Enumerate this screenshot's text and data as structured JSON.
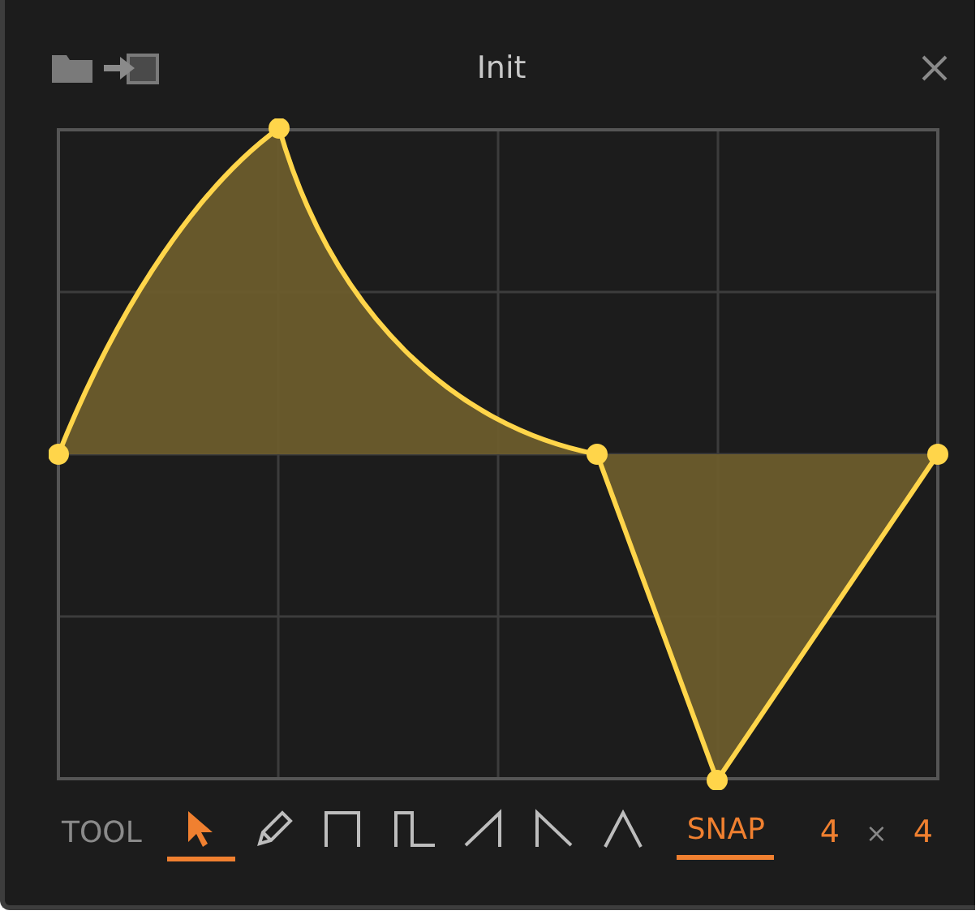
{
  "window": {
    "title": "Init"
  },
  "toolbar": {
    "label": "TOOL",
    "tools": [
      {
        "kind": "pointer",
        "selected": true
      },
      {
        "kind": "pencil",
        "selected": false
      },
      {
        "kind": "square",
        "selected": false
      },
      {
        "kind": "pulse",
        "selected": false
      },
      {
        "kind": "saw-up",
        "selected": false
      },
      {
        "kind": "saw-down",
        "selected": false
      },
      {
        "kind": "triangle",
        "selected": false
      }
    ],
    "snap": {
      "label": "SNAP",
      "on": true
    },
    "grid": {
      "columns": "4",
      "separator": "×",
      "rows": "4"
    }
  }
}
